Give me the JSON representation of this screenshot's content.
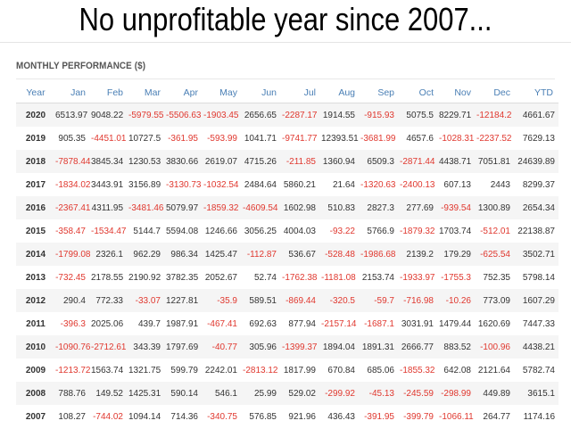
{
  "headline": "No unprofitable year since 2007...",
  "section_title": "MONTHLY PERFORMANCE ($)",
  "colors": {
    "header_text": "#4a7fb5",
    "negative": "#e0382f",
    "positive": "#333333",
    "stripe": "#f5f5f5"
  },
  "columns": [
    "Year",
    "Jan",
    "Feb",
    "Mar",
    "Apr",
    "May",
    "Jun",
    "Jul",
    "Aug",
    "Sep",
    "Oct",
    "Nov",
    "Dec",
    "YTD"
  ],
  "rows": [
    [
      "2020",
      "6513.97",
      "9048.22",
      "-5979.55",
      "-5506.63",
      "-1903.45",
      "2656.65",
      "-2287.17",
      "1914.55",
      "-915.93",
      "5075.5",
      "8229.71",
      "-12184.2",
      "4661.67"
    ],
    [
      "2019",
      "905.35",
      "-4451.01",
      "10727.5",
      "-361.95",
      "-593.99",
      "1041.71",
      "-9741.77",
      "12393.51",
      "-3681.99",
      "4657.6",
      "-1028.31",
      "-2237.52",
      "7629.13"
    ],
    [
      "2018",
      "-7878.44",
      "3845.34",
      "1230.53",
      "3830.66",
      "2619.07",
      "4715.26",
      "-211.85",
      "1360.94",
      "6509.3",
      "-2871.44",
      "4438.71",
      "7051.81",
      "24639.89"
    ],
    [
      "2017",
      "-1834.02",
      "3443.91",
      "3156.89",
      "-3130.73",
      "-1032.54",
      "2484.64",
      "5860.21",
      "21.64",
      "-1320.63",
      "-2400.13",
      "607.13",
      "2443",
      "8299.37"
    ],
    [
      "2016",
      "-2367.41",
      "4311.95",
      "-3481.46",
      "5079.97",
      "-1859.32",
      "-4609.54",
      "1602.98",
      "510.83",
      "2827.3",
      "277.69",
      "-939.54",
      "1300.89",
      "2654.34"
    ],
    [
      "2015",
      "-358.47",
      "-1534.47",
      "5144.7",
      "5594.08",
      "1246.66",
      "3056.25",
      "4004.03",
      "-93.22",
      "5766.9",
      "-1879.32",
      "1703.74",
      "-512.01",
      "22138.87"
    ],
    [
      "2014",
      "-1799.08",
      "2326.1",
      "962.29",
      "986.34",
      "1425.47",
      "-112.87",
      "536.67",
      "-528.48",
      "-1986.68",
      "2139.2",
      "179.29",
      "-625.54",
      "3502.71"
    ],
    [
      "2013",
      "-732.45",
      "2178.55",
      "2190.92",
      "3782.35",
      "2052.67",
      "52.74",
      "-1762.38",
      "-1181.08",
      "2153.74",
      "-1933.97",
      "-1755.3",
      "752.35",
      "5798.14"
    ],
    [
      "2012",
      "290.4",
      "772.33",
      "-33.07",
      "1227.81",
      "-35.9",
      "589.51",
      "-869.44",
      "-320.5",
      "-59.7",
      "-716.98",
      "-10.26",
      "773.09",
      "1607.29"
    ],
    [
      "2011",
      "-396.3",
      "2025.06",
      "439.7",
      "1987.91",
      "-467.41",
      "692.63",
      "877.94",
      "-2157.14",
      "-1687.1",
      "3031.91",
      "1479.44",
      "1620.69",
      "7447.33"
    ],
    [
      "2010",
      "-1090.76",
      "-2712.61",
      "343.39",
      "1797.69",
      "-40.77",
      "305.96",
      "-1399.37",
      "1894.04",
      "1891.31",
      "2666.77",
      "883.52",
      "-100.96",
      "4438.21"
    ],
    [
      "2009",
      "-1213.72",
      "1563.74",
      "1321.75",
      "599.79",
      "2242.01",
      "-2813.12",
      "1817.99",
      "670.84",
      "685.06",
      "-1855.32",
      "642.08",
      "2121.64",
      "5782.74"
    ],
    [
      "2008",
      "788.76",
      "149.52",
      "1425.31",
      "590.14",
      "546.1",
      "25.99",
      "529.02",
      "-299.92",
      "-45.13",
      "-245.59",
      "-298.99",
      "449.89",
      "3615.1"
    ],
    [
      "2007",
      "108.27",
      "-744.02",
      "1094.14",
      "714.36",
      "-340.75",
      "576.85",
      "921.96",
      "436.43",
      "-391.95",
      "-399.79",
      "-1066.11",
      "264.77",
      "1174.16"
    ]
  ]
}
